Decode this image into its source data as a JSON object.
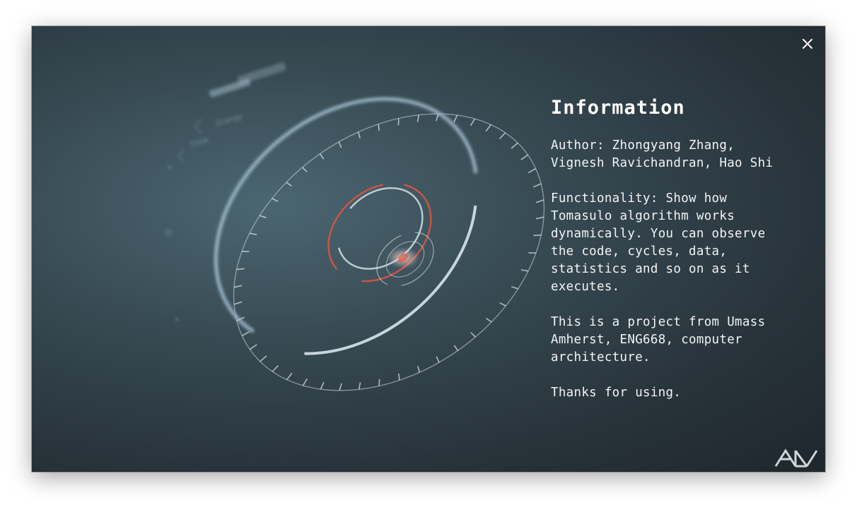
{
  "dialog": {
    "close_icon": "close-icon",
    "logo_icon": "ad-logo-icon"
  },
  "hud": {
    "labels": [
      "Energy",
      "Time"
    ]
  },
  "info": {
    "title": "Information",
    "author": "Author: Zhongyang Zhang, Vignesh Ravichandran, Hao Shi",
    "functionality": "Functionality: Show how Tomasulo algorithm works dynamically. You can observe the code, cycles, data, statistics and so on as it executes.",
    "project": "This is a project from Umass Amherst, ENG668, computer architecture.",
    "thanks": "Thanks for using."
  },
  "colors": {
    "accent_red": "#d9553f",
    "ring_blue": "#a9c6d6",
    "text": "#f2f4f5"
  }
}
